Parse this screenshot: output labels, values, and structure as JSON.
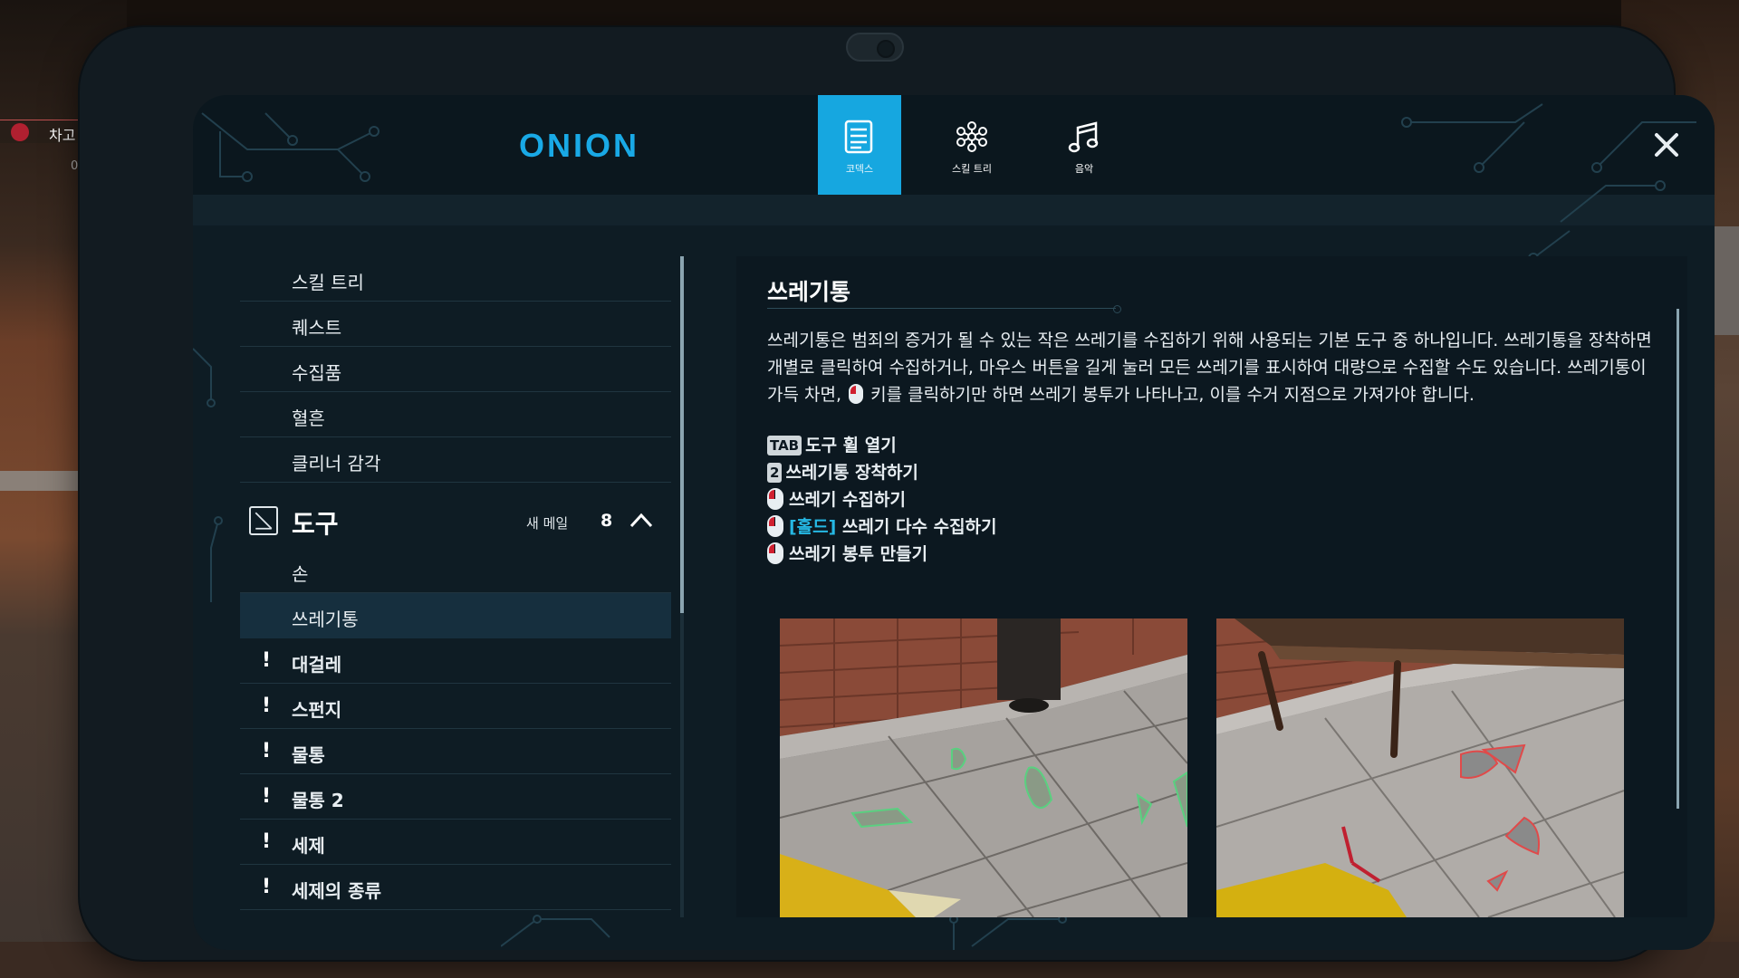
{
  "hud": {
    "label": "차고",
    "sub": "0"
  },
  "header": {
    "logo": "ONION",
    "tabs": [
      {
        "label": "코덱스",
        "icon": "codex-icon",
        "active": true
      },
      {
        "label": "스킬 트리",
        "icon": "skill-tree-icon",
        "active": false
      },
      {
        "label": "음악",
        "icon": "music-icon",
        "active": false
      }
    ],
    "close_icon": "close-icon"
  },
  "sidebar": {
    "items": [
      {
        "label": "스킬 트리"
      },
      {
        "label": "퀘스트"
      },
      {
        "label": "수집품"
      },
      {
        "label": "혈흔"
      },
      {
        "label": "클리너 감각"
      }
    ],
    "section": {
      "title": "도구",
      "new_label": "새 메일",
      "new_count": "8",
      "icon": "tools-icon",
      "toggle_icon": "chevron-up-icon"
    },
    "section_items": [
      {
        "label": "손",
        "bang": "",
        "selected": false
      },
      {
        "label": "쓰레기통",
        "bang": "",
        "selected": true
      },
      {
        "label": "대걸레",
        "bang": "!",
        "selected": false
      },
      {
        "label": "스펀지",
        "bang": "!",
        "selected": false
      },
      {
        "label": "물통",
        "bang": "!",
        "selected": false
      },
      {
        "label": "물통 2",
        "bang": "!",
        "selected": false
      },
      {
        "label": "세제",
        "bang": "!",
        "selected": false
      },
      {
        "label": "세제의 종류",
        "bang": "!",
        "selected": false
      }
    ]
  },
  "content": {
    "title": "쓰레기통",
    "desc_part1": "쓰레기통은 범죄의 증거가 될 수 있는 작은 쓰레기를 수집하기 위해 사용되는 기본 도구 중 하나입니다. 쓰레기통을 장착하면 개별로 클릭하여 수집하거나, 마우스 버튼을 길게 눌러 모든 쓰레기를 표시하여 대량으로 수집할 수도 있습니다. 쓰레기통이 가득 차면,",
    "desc_part2": "키를 클릭하기만 하면 쓰레기 봉투가 나타나고, 이를 수거 지점으로 가져가야 합니다.",
    "controls": [
      {
        "key": "TAB",
        "mouse": false,
        "hold": "",
        "text": "도구 휠 열기"
      },
      {
        "key": "2",
        "mouse": false,
        "hold": "",
        "text": "쓰레기통 장착하기"
      },
      {
        "key": "",
        "mouse": true,
        "hold": "",
        "text": "쓰레기 수집하기"
      },
      {
        "key": "",
        "mouse": true,
        "hold": "[홀드]",
        "text": "쓰레기 다수 수집하기"
      },
      {
        "key": "",
        "mouse": true,
        "hold": "",
        "text": "쓰레기 봉투 만들기"
      }
    ]
  },
  "colors": {
    "accent": "#16a7e0",
    "panel": "#0e1c24",
    "selected": "#162f3e",
    "hold": "#26b8e4",
    "mouse_button": "#d02030"
  }
}
